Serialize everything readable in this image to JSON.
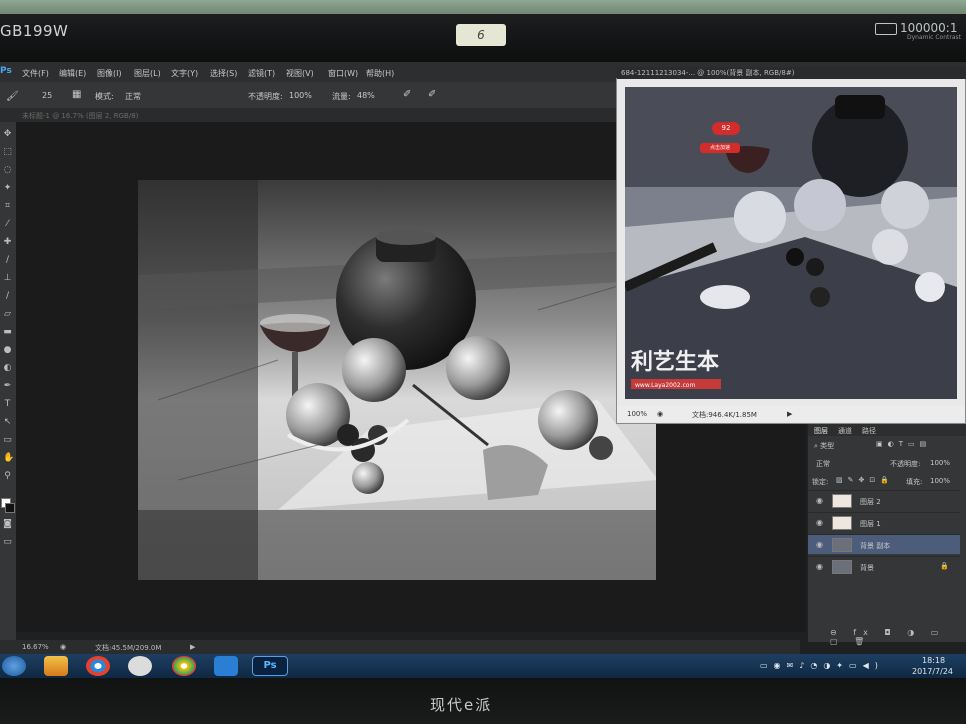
{
  "monitor": {
    "model": "GB199W",
    "sticker": "6",
    "contrast": "100000:1",
    "contrast_sub": "Dynamic Contrast",
    "brand": "现代e派"
  },
  "ps": {
    "logo": "Ps",
    "menu": [
      "文件(F)",
      "编辑(E)",
      "图像(I)",
      "图层(L)",
      "文字(Y)",
      "选择(S)",
      "滤镜(T)",
      "视图(V)",
      "窗口(W)",
      "帮助(H)"
    ],
    "options": {
      "brush_size": "25",
      "mode_label": "模式:",
      "mode_value": "正常",
      "opacity_label": "不透明度:",
      "opacity_value": "100%",
      "flow_label": "流量:",
      "flow_value": "48%"
    },
    "tab_title": "未标题-1 @ 16.7% (图层 2, RGB/8)",
    "status_zoom": "16.67%",
    "status_doc": "文档:45.5M/209.0M",
    "float_title": "684-12111213034-... @ 100%(背景 副本, RGB/8#)",
    "float_badge": "92",
    "float_badge2": "点击加速",
    "float_watermark": "利艺生本",
    "float_url": "www.Laya2002.com",
    "float_zoom": "100%",
    "float_doc": "文档:946.4K/1.85M",
    "layers": {
      "tabs": [
        "图层",
        "通道",
        "路径"
      ],
      "kind_label": "类型",
      "blend_mode": "正常",
      "opacity_label": "不透明度:",
      "opacity_value": "100%",
      "lock_label": "锁定:",
      "fill_label": "填充:",
      "fill_value": "100%",
      "items": [
        {
          "name": "图层 2",
          "selected": false
        },
        {
          "name": "图层 1",
          "selected": false
        },
        {
          "name": "背景 副本",
          "selected": true
        },
        {
          "name": "背景",
          "selected": false
        }
      ]
    }
  },
  "taskbar": {
    "time": "18:18",
    "date": "2017/7/24",
    "apps": [
      "windows-start-icon",
      "app-icon",
      "player-icon",
      "cat-icon",
      "chrome-icon",
      "sogou-icon",
      "photoshop-icon"
    ]
  },
  "icons": [
    "tray-icons"
  ]
}
